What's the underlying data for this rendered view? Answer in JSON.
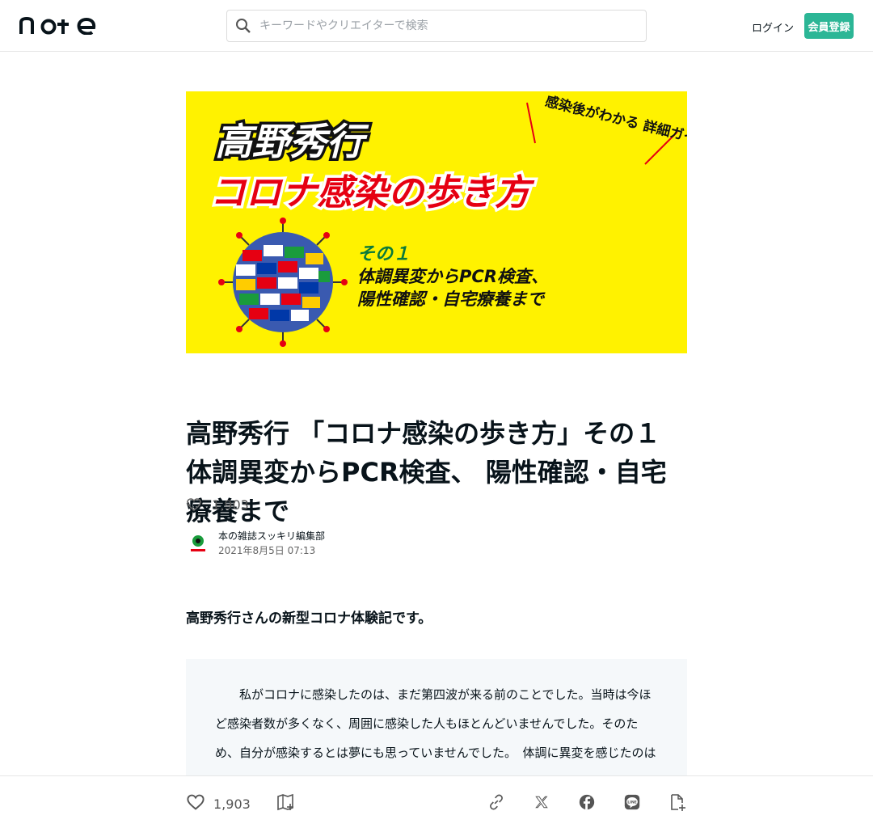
{
  "header": {
    "logo_text": "note",
    "search_placeholder": "キーワードやクリエイターで検索",
    "login_label": "ログイン",
    "signup_label": "会員登録"
  },
  "hero": {
    "line1": "高野秀行",
    "line2": "コロナ感染の歩き方",
    "corner": "感染後がわかる 詳細ガイド",
    "part": "その１",
    "sub1": "体調異変からPCR検査、",
    "sub2": "陽性確認・自宅療養まで"
  },
  "article": {
    "title": "高野秀行 「コロナ感染の歩き方」その１ 体調異変からPCR検査、 陽性確認・自宅療養まで",
    "like_count": "1,903",
    "author_name": "本の雑誌スッキリ編集部",
    "date": "2021年8月5日 07:13",
    "lead": "高野秀行さんの新型コロナ体験記です。",
    "quote": "　私がコロナに感染したのは、まだ第四波が来る前のことでした。当時は今ほど感染者数が多くなく、周囲に感染した人もほとんどいませんでした。そのため、自分が感染するとは夢にも思っていませんでした。　体調に異変を感じたのはある日の夕方のことで、最初はただの疲れだろうと思っていたのですが、夜になって熱が出てきたのです。翌日も熱は下がらず、これはもしかしたらと思い始めました。"
  },
  "bottom_bar": {
    "like_count": "1,903"
  },
  "colors": {
    "accent": "#2cb696",
    "hero_bg": "#fff200",
    "hero_red": "#e60012",
    "hero_green": "#0a7a3b"
  }
}
